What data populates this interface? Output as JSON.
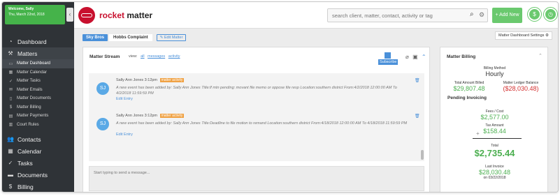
{
  "sidebar": {
    "welcome_line1": "Welcome, Sally",
    "welcome_line2": "Thu, March 22nd, 2018",
    "collapse_glyph": "‹",
    "items": [
      {
        "label": "Dashboard",
        "icon": "gauge-icon"
      },
      {
        "label": "Matters",
        "icon": "gavel-icon"
      }
    ],
    "subitems": [
      {
        "label": "Matter Dashboard",
        "icon": "dashboard-icon"
      },
      {
        "label": "Matter Calendar",
        "icon": "calendar-icon"
      },
      {
        "label": "Matter Tasks",
        "icon": "check-icon"
      },
      {
        "label": "Matter Emails",
        "icon": "envelope-icon"
      },
      {
        "label": "Matter Documents",
        "icon": "document-icon"
      },
      {
        "label": "Matter Billing",
        "icon": "dollar-icon"
      },
      {
        "label": "Matter Payments",
        "icon": "payment-icon"
      },
      {
        "label": "Court Rules",
        "icon": "book-icon"
      }
    ],
    "items_bottom": [
      {
        "label": "Contacts",
        "icon": "people-icon"
      },
      {
        "label": "Calendar",
        "icon": "calendar-icon"
      },
      {
        "label": "Tasks",
        "icon": "check-icon"
      },
      {
        "label": "Documents",
        "icon": "folder-icon"
      },
      {
        "label": "Billing",
        "icon": "dollar-icon"
      }
    ]
  },
  "header": {
    "logo_word1": "rocket",
    "logo_word2": " matter",
    "search_placeholder": "search client, matter, contact, activity or tag",
    "add_label": "+ Add New",
    "round_buttons": [
      "$",
      "◷"
    ]
  },
  "tabs": {
    "client": "Sky Bros",
    "matter": "Hobbs Complaint",
    "edit": "✎ Edit Matter"
  },
  "dashboard_settings": "Matter Dashboard Settings ⚙",
  "stream": {
    "title": "Matter Stream",
    "view_label": "view:",
    "view_links": [
      "all",
      "messages",
      "activity"
    ],
    "subscribe": "Subscribe",
    "entries": [
      {
        "initials": "SJ",
        "author": "Sally Ann Jones",
        "time": "3:12pm",
        "badge": "matter activity",
        "message": "A new event has been added by: Sally Ann Jones Title:lf mtn pending: movant file memo or oppose file resp Location:southern district From:4/2/2018 12:00:00 AM To 4/2/2018 11:59:59 PM",
        "edit": "Edit Entry"
      },
      {
        "initials": "SJ",
        "author": "Sally Ann Jones",
        "time": "3:12pm",
        "badge": "matter activity",
        "message": "A new event has been added by: Sally Ann Jones Title:Deadline to file motion to remand Location:southern district From:4/18/2018 12:00:00 AM To 4/18/2018 11:59:59 PM",
        "edit": "Edit Entry"
      }
    ],
    "compose_placeholder": "Start typing to send a message..."
  },
  "billing": {
    "title": "Matter Billing",
    "method_label": "Billing Method",
    "method_value": "Hourly",
    "billed_label": "Total Amount Billed",
    "billed_value": "$29,807.48",
    "ledger_label": "Matter Ledger Balance",
    "ledger_value": "($28,030.48)",
    "pending_label": "Pending Invoicing",
    "fees_label": "Fees / Cost",
    "fees_value": "$2,577.00",
    "tax_label": "Tax Amount",
    "tax_value": "$158.44",
    "total_label": "Total",
    "total_value": "$2,735.44",
    "last_label": "Last Invoice",
    "last_value": "$28,030.48",
    "last_date": "on 03/22/2018"
  },
  "colors": {
    "sidebar_bg": "#2f3337",
    "accent_green": "#6ac96e",
    "welcome_green": "#45b34a",
    "brand_red": "#c8102e",
    "link_blue": "#4a90d9",
    "badge_orange": "#f0a142"
  }
}
